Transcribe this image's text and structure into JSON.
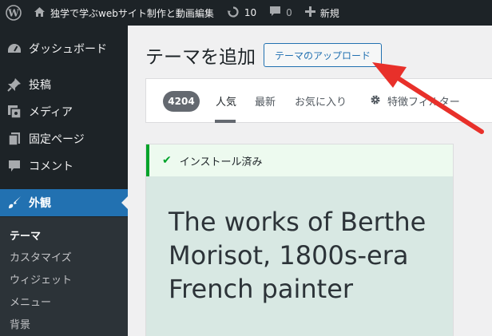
{
  "adminbar": {
    "site_name": "独学で学ぶwebサイト制作と動画編集",
    "updates_count": "10",
    "comments_count": "0",
    "new_label": "新規"
  },
  "sidebar": {
    "items": [
      {
        "label": "ダッシュボード",
        "icon": "dashboard-icon"
      },
      {
        "label": "投稿",
        "icon": "pin-icon"
      },
      {
        "label": "メディア",
        "icon": "media-icon"
      },
      {
        "label": "固定ページ",
        "icon": "page-icon"
      },
      {
        "label": "コメント",
        "icon": "comment-icon"
      },
      {
        "label": "外観",
        "icon": "brush-icon"
      }
    ],
    "submenu": [
      "テーマ",
      "カスタマイズ",
      "ウィジェット",
      "メニュー",
      "背景"
    ]
  },
  "main": {
    "title": "テーマを追加",
    "upload_button": "テーマのアップロード",
    "filter": {
      "count": "4204",
      "tabs": [
        "人気",
        "最新",
        "お気に入り"
      ],
      "feature_filter": "特徴フィルター"
    },
    "card": {
      "notice": "インストール済み",
      "title": "The works of Berthe Morisot, 1800s-era French painter"
    }
  },
  "colors": {
    "admin_bg": "#1d2327",
    "accent": "#2271b1",
    "success": "#00a32a",
    "annotation_arrow": "#e8302a"
  }
}
